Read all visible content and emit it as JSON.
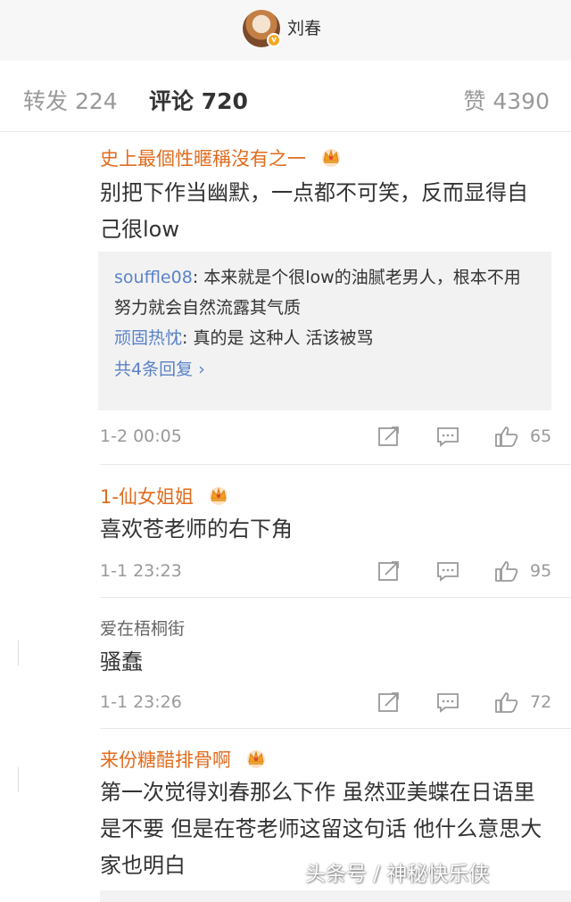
{
  "header": {
    "username": "刘春",
    "verified_badge": "v"
  },
  "tabs": [
    {
      "label": "转发",
      "count": "224"
    },
    {
      "label": "评论",
      "count": "720"
    },
    {
      "label": "赞",
      "count": "4390"
    }
  ],
  "comments": [
    {
      "name": "史上最個性暱稱沒有之一",
      "text": "别把下作当幽默，一点都不可笑，反而显得自己很low",
      "replies": [
        {
          "user": "souffle08",
          "text": ": 本来就是个很low的油腻老男人，根本不用努力就会自然流露其气质"
        },
        {
          "user": "顽固热忱",
          "text": ": 真的是 这种人 活该被骂"
        }
      ],
      "more_replies": "共4条回复 ›",
      "time": "1-2 00:05",
      "likes": "65"
    },
    {
      "name": "1-仙女姐姐",
      "text": "喜欢苍老师的右下角",
      "time": "1-1 23:23",
      "likes": "95"
    },
    {
      "name": "爱在梧桐街",
      "text": "骚蠢",
      "time": "1-1 23:26",
      "likes": "72"
    },
    {
      "name": "来份糖醋排骨啊",
      "text": "第一次觉得刘春那么下作 虽然亚美蝶在日语里是不要 但是在苍老师这留这句话 他什么意思大家也明白"
    }
  ],
  "watermark": "头条号 / 神秘快乐侠",
  "colors": {
    "vip_name": "#e06c1e",
    "link_blue": "#5a82c8",
    "meta_gray": "#999999"
  }
}
